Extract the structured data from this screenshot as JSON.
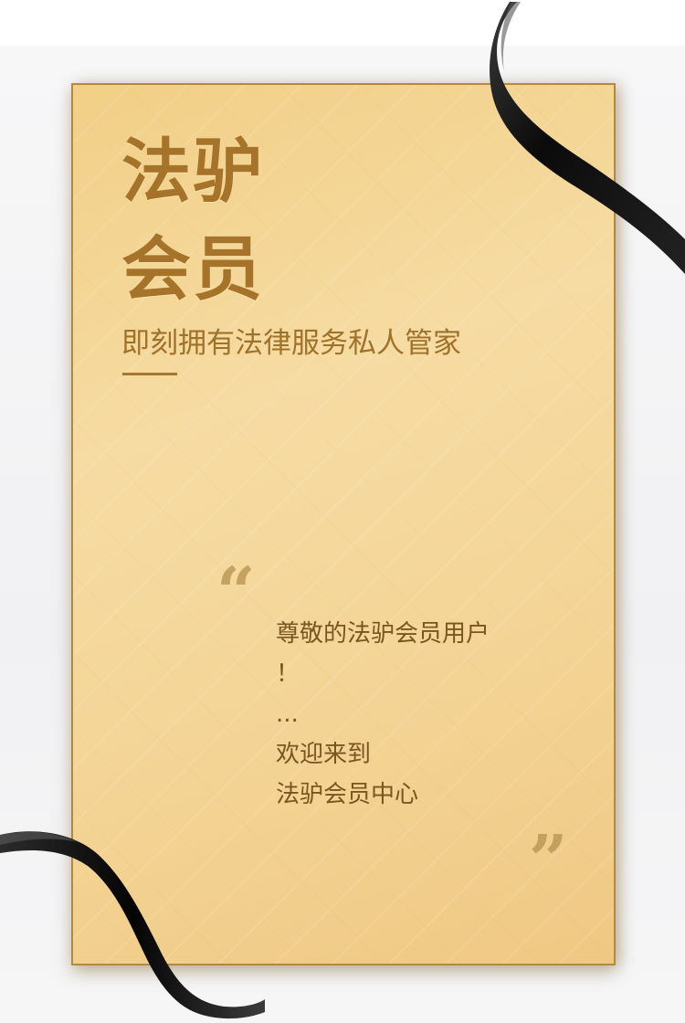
{
  "card": {
    "title_line1": "法驴",
    "title_line2": "会员",
    "subtitle": "即刻拥有法律服务私人管家",
    "quote_open": "“",
    "quote_close": "”",
    "message_lines": [
      "尊敬的法驴会员用户",
      "！",
      "...",
      "欢迎来到",
      "法驴会员中心"
    ]
  },
  "colors": {
    "card_gold": "#f4d597",
    "title_gold": "#a5732a",
    "message_brown": "#7a5520",
    "ribbon_black": "#111111"
  }
}
